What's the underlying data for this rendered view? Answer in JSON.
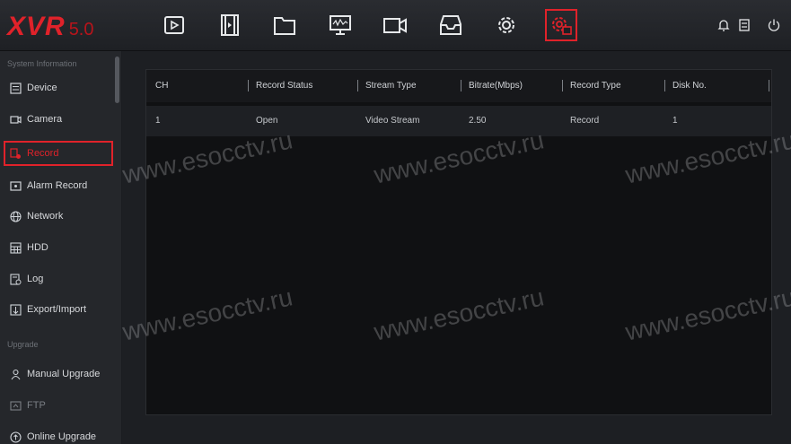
{
  "app": {
    "logo_main": "XVR",
    "logo_version": "5.0"
  },
  "topnav": [
    {
      "icon": "playback-icon"
    },
    {
      "icon": "film-icon"
    },
    {
      "icon": "folder-icon"
    },
    {
      "icon": "monitor-icon"
    },
    {
      "icon": "camera-icon"
    },
    {
      "icon": "tray-icon"
    },
    {
      "icon": "gear-icon"
    },
    {
      "icon": "system-settings-icon",
      "active": true
    }
  ],
  "topright": [
    {
      "icon": "bell-icon"
    },
    {
      "icon": "disk-icon"
    },
    {
      "icon": "power-icon"
    }
  ],
  "sidebar": {
    "section1": "System Information",
    "items": [
      {
        "label": "Device",
        "icon": "device-icon"
      },
      {
        "label": "Camera",
        "icon": "camera-small-icon"
      },
      {
        "label": "Record",
        "icon": "record-icon",
        "selected": true
      },
      {
        "label": "Alarm Record",
        "icon": "alarm-record-icon"
      },
      {
        "label": "Network",
        "icon": "network-icon"
      },
      {
        "label": "HDD",
        "icon": "hdd-icon"
      },
      {
        "label": "Log",
        "icon": "log-icon"
      },
      {
        "label": "Export/Import",
        "icon": "export-import-icon"
      }
    ],
    "section2": "Upgrade",
    "items2": [
      {
        "label": "Manual Upgrade",
        "icon": "manual-upgrade-icon"
      },
      {
        "label": "FTP",
        "icon": "ftp-icon",
        "dim": true
      },
      {
        "label": "Online Upgrade",
        "icon": "online-upgrade-icon"
      }
    ]
  },
  "table": {
    "headers": [
      "CH",
      "Record Status",
      "Stream Type",
      "Bitrate(Mbps)",
      "Record Type",
      "Disk No."
    ],
    "rows": [
      [
        "1",
        "Open",
        "Video Stream",
        "2.50",
        "Record",
        "1"
      ]
    ]
  },
  "watermark": "www.esocctv.ru",
  "colors": {
    "accent": "#e0222a",
    "background": "#1b1d21"
  }
}
